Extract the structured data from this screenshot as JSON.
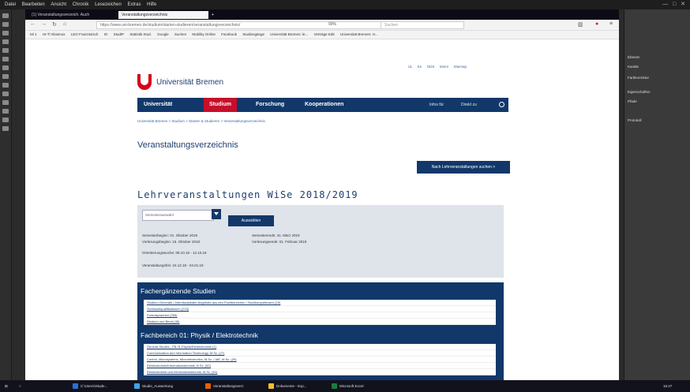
{
  "appmenu": {
    "items": [
      "Datei",
      "Bearbeiten",
      "Ansicht",
      "Chronik",
      "Lesezeichen",
      "Extras",
      "Hilfe"
    ]
  },
  "tabs": [
    {
      "label": "(1) Veranstaltungsverzeich. Auch",
      "active": false
    },
    {
      "label": "Veranstaltungsverzeichnis",
      "active": true
    }
  ],
  "navbar": {
    "url": "https://www.uni-bremen.de/studium/starten-studieren/veranstaltungsverzeichnis/",
    "zoom": "90%",
    "search_placeholder": "Suchen"
  },
  "bookmarks": [
    "Mi 1",
    "HI-Tl Glasmus",
    "LEO Französisch",
    "IO",
    "StudIP",
    "Statistik Stud.",
    "Google",
    "Suchen",
    "Mobility Online",
    "Facebook",
    "Studiengänge",
    "Universität Bremen: le...",
    "Verträge Edit",
    "Universität Bremen: H..."
  ],
  "page": {
    "toplinks": [
      "UL",
      "En",
      "ODS",
      "Intern",
      "Sitemap"
    ],
    "logo_text": "Universität Bremen",
    "nav": {
      "universitat": "Universität",
      "studium": "Studium",
      "forschung": "Forschung",
      "kooperationen": "Kooperationen",
      "infos": "Infos für",
      "direkt": "Direkt zu"
    },
    "breadcrumb": "Universität Bremen > Studium > Starten & Studieren > Veranstaltungsverzeichnis",
    "title": "Veranstaltungsverzeichnis",
    "cta": "Nach Lehrveranstaltungen suchen >",
    "lv_title": "Lehrveranstaltungen WiSe 2018/2019",
    "filter": {
      "select_value": "Semesterauswahl",
      "button": "Auswählen",
      "sem_begin": "Semesterbeginn: 01. Oktober 2018",
      "sem_end": "Semesterende: 31. März 2019",
      "lect_begin": "Vorlesungsbeginn: 15. Oktober 2018",
      "lect_end": "Vorlesungsende: 01. Februar 2019",
      "orientation": "Orientierungswoche: 08.10.18 - 12.10.18",
      "break": "Veranstaltungsfrei: 24.12.18 - 04.01.19"
    },
    "cat1": {
      "title": "Fachergänzende Studien",
      "items": [
        "Studium Generale / Interdisziplinäre Angebote aus den Fachbereichen / Sachkompetenzen (19)",
        "Schlüsselqualifikationen (215)",
        "Fremdsprachen (255)",
        "Studium und Beruf (45)"
      ]
    },
    "cat2": {
      "title": "Fachbereich 01: Physik / Elektrotechnik",
      "items": [
        "General Studies - FB 01 Physik/Elektrotechnik (1)",
        "Communication and Information Technology, M.Sc. (27)",
        "Control, Microsystems, Microelectronics, M.Sc. / IAE, M.Sc. (29)",
        "Elektrotechnik/Informationstechnik, B.Sc. (52)",
        "Elektrotechnik und Informationstechnik, M.Sc. (61)"
      ]
    }
  },
  "rightpanel": {
    "items": [
      "Ebenen",
      "Kanäle",
      "Farbkorrektur",
      "Eigenschaften",
      "Pfade",
      "Protokoll"
    ]
  },
  "taskbar": {
    "items": [
      "C:\\Users\\Stude...",
      "Studie_Auswertung",
      "Veranstaltungsverz.",
      "Dokumente - Exp...",
      "Microsoft Excel"
    ],
    "time": "16:47"
  }
}
